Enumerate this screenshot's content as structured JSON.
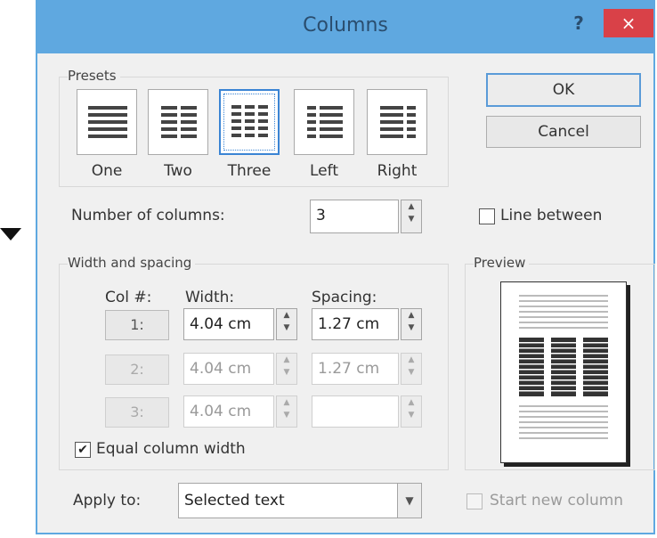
{
  "dialog": {
    "title": "Columns",
    "help_label": "?",
    "close_label": "×"
  },
  "presets": {
    "group_label": "Presets",
    "items": [
      {
        "label": "One",
        "icon": "one-column-icon"
      },
      {
        "label": "Two",
        "icon": "two-columns-icon"
      },
      {
        "label": "Three",
        "icon": "three-columns-icon"
      },
      {
        "label": "Left",
        "icon": "left-column-icon"
      },
      {
        "label": "Right",
        "icon": "right-column-icon"
      }
    ],
    "selected": "Three"
  },
  "buttons": {
    "ok": "OK",
    "cancel": "Cancel"
  },
  "number_of_columns": {
    "label": "Number of columns:",
    "value": "3"
  },
  "line_between": {
    "label": "Line between",
    "checked": false
  },
  "width_spacing": {
    "group_label": "Width and spacing",
    "col_header": "Col #:",
    "width_header": "Width:",
    "spacing_header": "Spacing:",
    "rows": [
      {
        "col": "1:",
        "width": "4.04 cm",
        "spacing": "1.27 cm"
      },
      {
        "col": "2:",
        "width": "4.04 cm",
        "spacing": "1.27 cm"
      },
      {
        "col": "3:",
        "width": "4.04 cm",
        "spacing": ""
      }
    ]
  },
  "equal_column_width": {
    "label": "Equal column width",
    "checked": true,
    "check_mark": "✔"
  },
  "preview": {
    "group_label": "Preview"
  },
  "apply_to": {
    "label": "Apply to:",
    "value": "Selected text"
  },
  "start_new_column": {
    "label": "Start new column",
    "checked": false
  },
  "colors": {
    "title_bar": "#5fa8e0",
    "close_button": "#d94148",
    "selection_border": "#3a84d4"
  }
}
